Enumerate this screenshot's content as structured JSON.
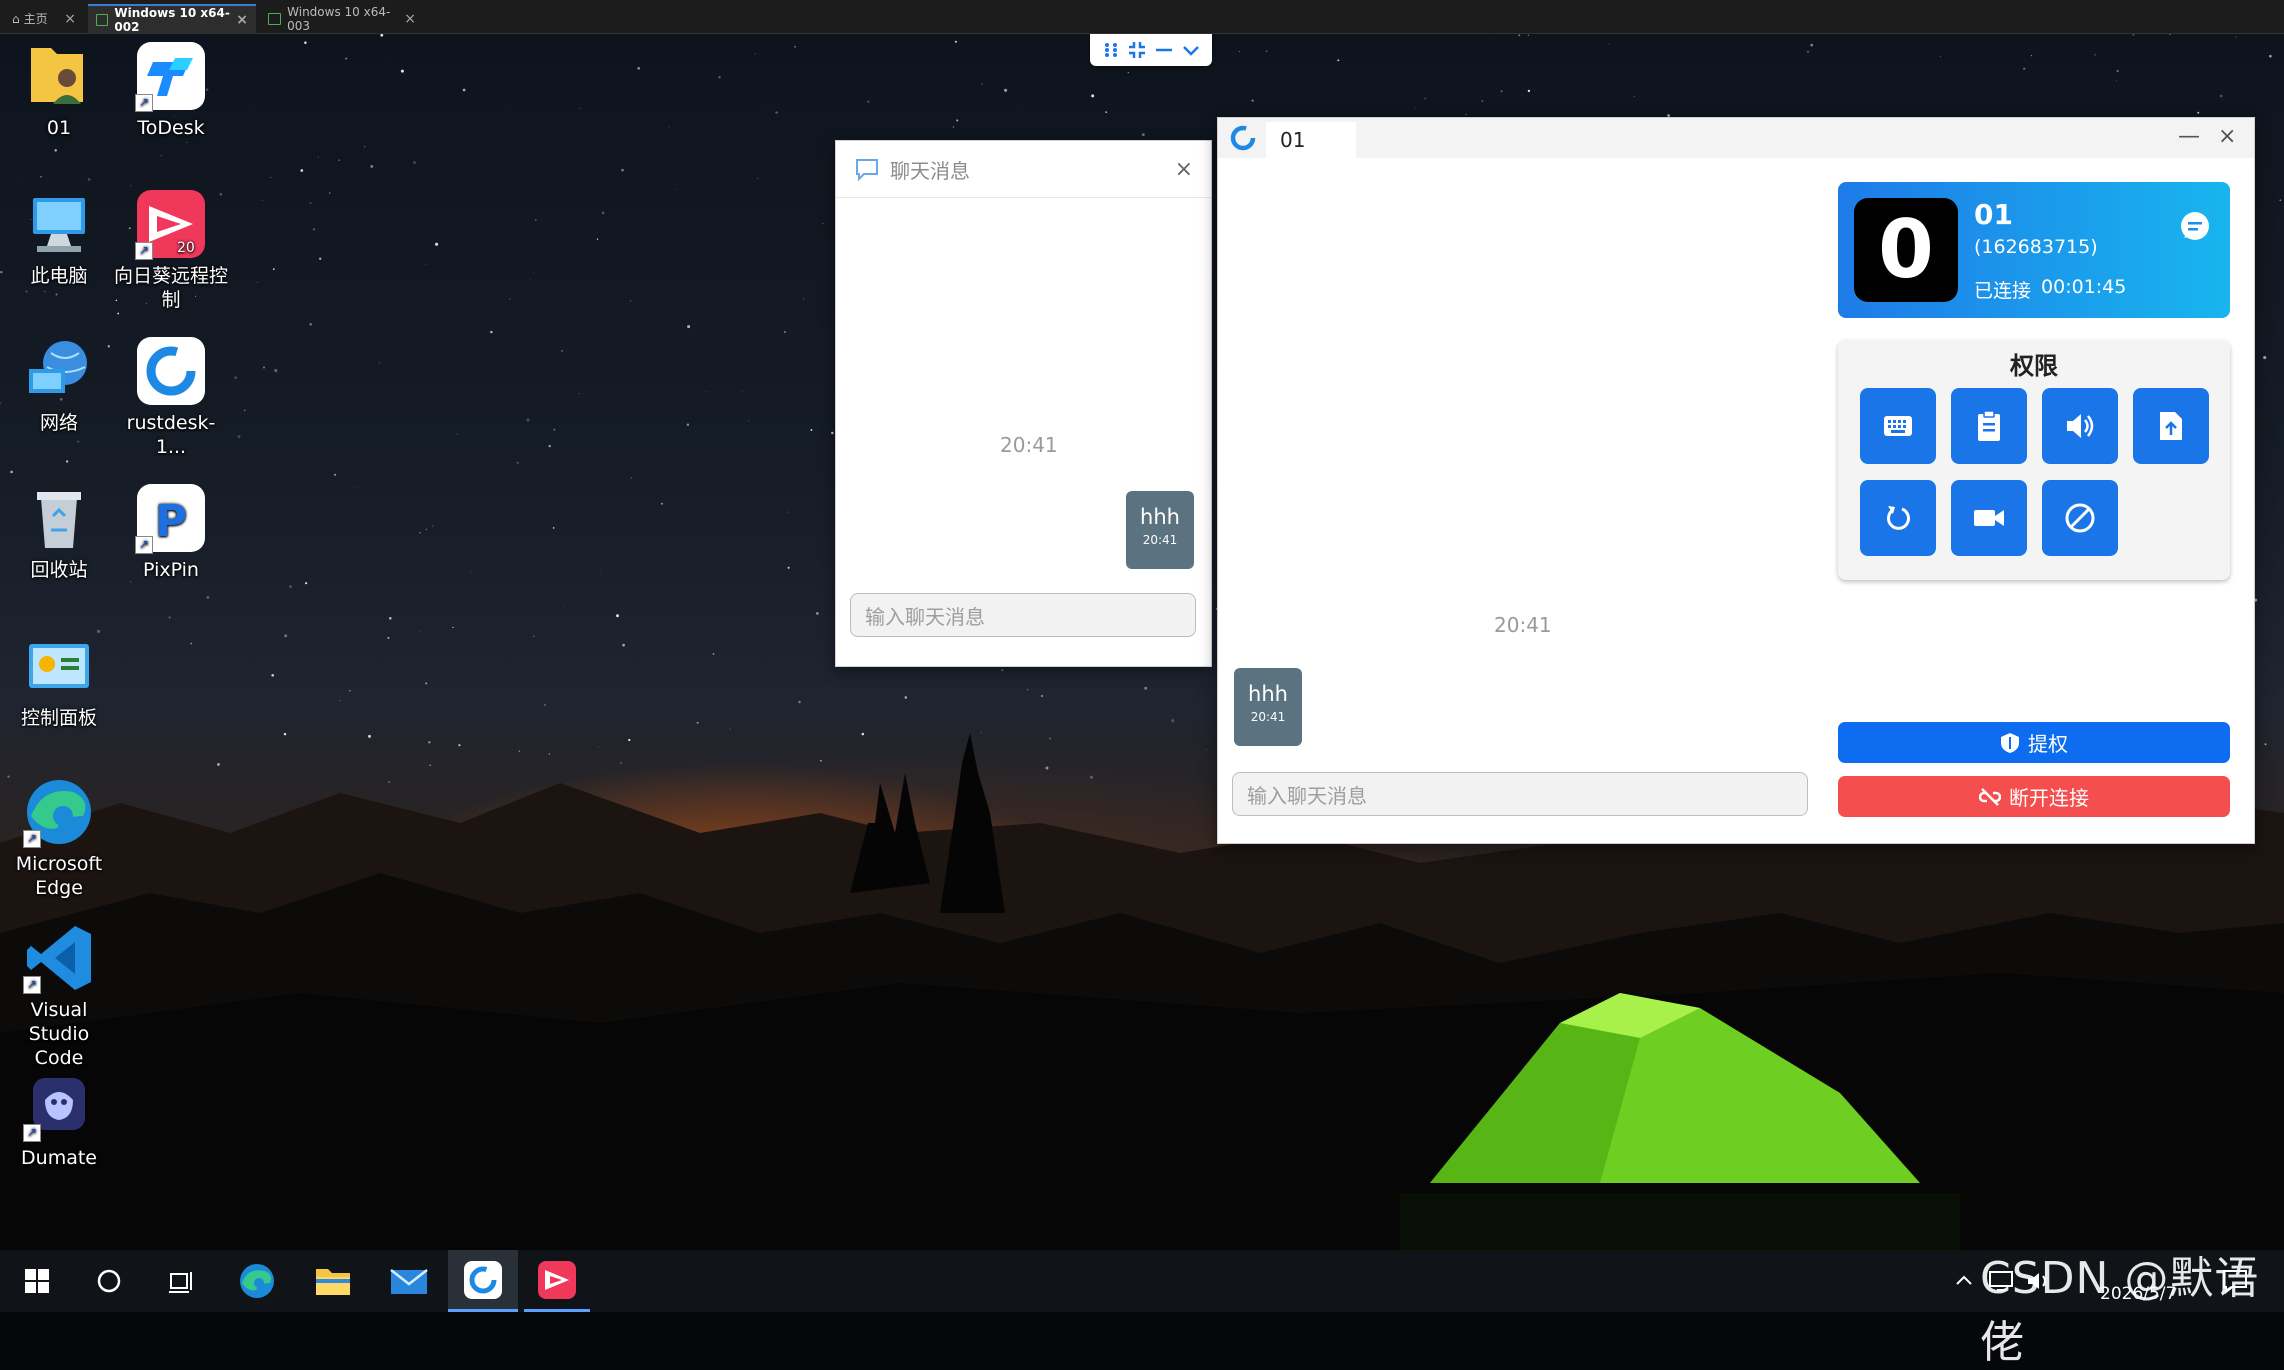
{
  "vm_tabs": [
    {
      "label": "主页"
    },
    {
      "label": "Windows 10 x64-002"
    },
    {
      "label": "Windows 10 x64-003"
    }
  ],
  "desktop_icons": [
    {
      "label": "01"
    },
    {
      "label": "ToDesk"
    },
    {
      "label": "此电脑"
    },
    {
      "label": "向日葵远程控制"
    },
    {
      "label": "网络"
    },
    {
      "label": "rustdesk-1..."
    },
    {
      "label": "回收站"
    },
    {
      "label": "PixPin"
    },
    {
      "label": "控制面板"
    },
    {
      "label": "Microsoft Edge"
    },
    {
      "label": "Visual Studio Code"
    },
    {
      "label": "Dumate"
    }
  ],
  "chat_window": {
    "title": "聊天消息",
    "timestamp": "20:41",
    "message": {
      "text": "hhh",
      "time": "20:41"
    },
    "input_placeholder": "输入聊天消息"
  },
  "rustdesk": {
    "tab_label": "01",
    "timestamp": "20:41",
    "message": {
      "text": "hhh",
      "time": "20:41"
    },
    "input_placeholder": "输入聊天消息",
    "card": {
      "avatar_letter": "0",
      "name": "01",
      "id": "(162683715)",
      "status": "已连接",
      "duration": "00:01:45"
    },
    "permissions_title": "权限",
    "permissions": [
      "keyboard-icon",
      "clipboard-icon",
      "audio-icon",
      "file-transfer-icon",
      "restart-icon",
      "recording-icon",
      "block-input-icon"
    ],
    "elevate_label": "提权",
    "disconnect_label": "断开连接",
    "colors": {
      "accent": "#1a76e8",
      "danger": "#f44e4e"
    }
  },
  "taskbar": {
    "clock_date": "2026/5/7",
    "watermark": "CSDN @默语佬"
  }
}
